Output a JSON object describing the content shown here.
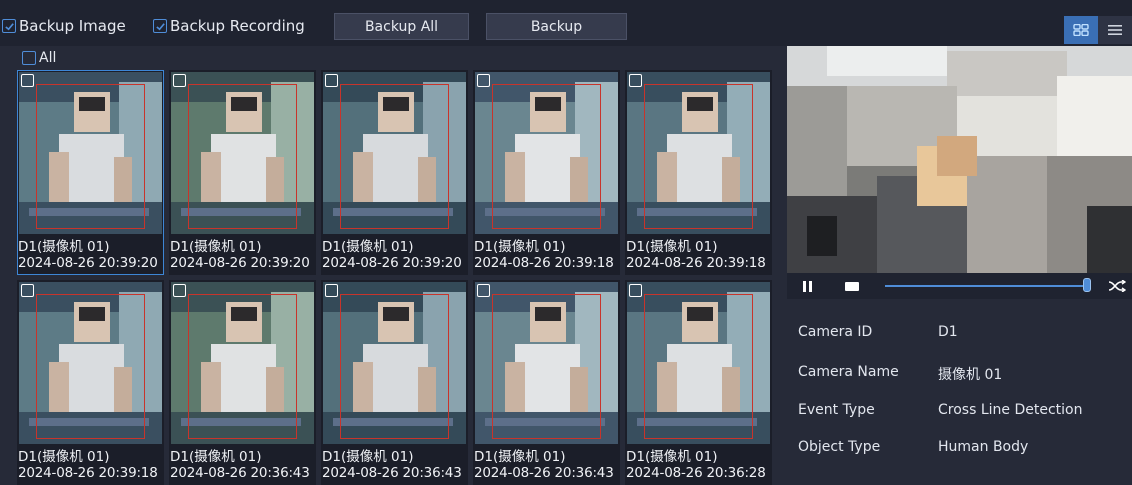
{
  "toolbar": {
    "backup_image": {
      "label": "Backup Image",
      "checked": true
    },
    "backup_recording": {
      "label": "Backup Recording",
      "checked": true
    },
    "backup_all_label": "Backup All",
    "backup_label": "Backup"
  },
  "grid": {
    "select_all_label": "All",
    "tiles": [
      {
        "camera": "D1(摄像机 01)",
        "time": "2024-08-26 20:39:20",
        "selected": true
      },
      {
        "camera": "D1(摄像机 01)",
        "time": "2024-08-26 20:39:20",
        "selected": false
      },
      {
        "camera": "D1(摄像机 01)",
        "time": "2024-08-26 20:39:20",
        "selected": false
      },
      {
        "camera": "D1(摄像机 01)",
        "time": "2024-08-26 20:39:18",
        "selected": false
      },
      {
        "camera": "D1(摄像机 01)",
        "time": "2024-08-26 20:39:18",
        "selected": false
      },
      {
        "camera": "D1(摄像机 01)",
        "time": "2024-08-26 20:39:18",
        "selected": false
      },
      {
        "camera": "D1(摄像机 01)",
        "time": "2024-08-26 20:36:43",
        "selected": false
      },
      {
        "camera": "D1(摄像机 01)",
        "time": "2024-08-26 20:36:43",
        "selected": false
      },
      {
        "camera": "D1(摄像机 01)",
        "time": "2024-08-26 20:36:43",
        "selected": false
      },
      {
        "camera": "D1(摄像机 01)",
        "time": "2024-08-26 20:36:28",
        "selected": false
      }
    ]
  },
  "player": {
    "progress": 0.98
  },
  "details": {
    "camera_id": {
      "label": "Camera ID",
      "value": "D1"
    },
    "camera_name": {
      "label": "Camera Name",
      "value": "摄像机 01"
    },
    "event_type": {
      "label": "Event Type",
      "value": "Cross Line Detection"
    },
    "object_type": {
      "label": "Object Type",
      "value": "Human Body"
    }
  },
  "colors": {
    "accent": "#3a6fb5",
    "detection_box": "#c8342b",
    "background": "#262a38"
  },
  "icons": {
    "view_grid": "grid-view-icon",
    "view_list": "list-view-icon",
    "pause": "pause-icon",
    "stop": "stop-icon",
    "shuffle": "shuffle-icon"
  }
}
